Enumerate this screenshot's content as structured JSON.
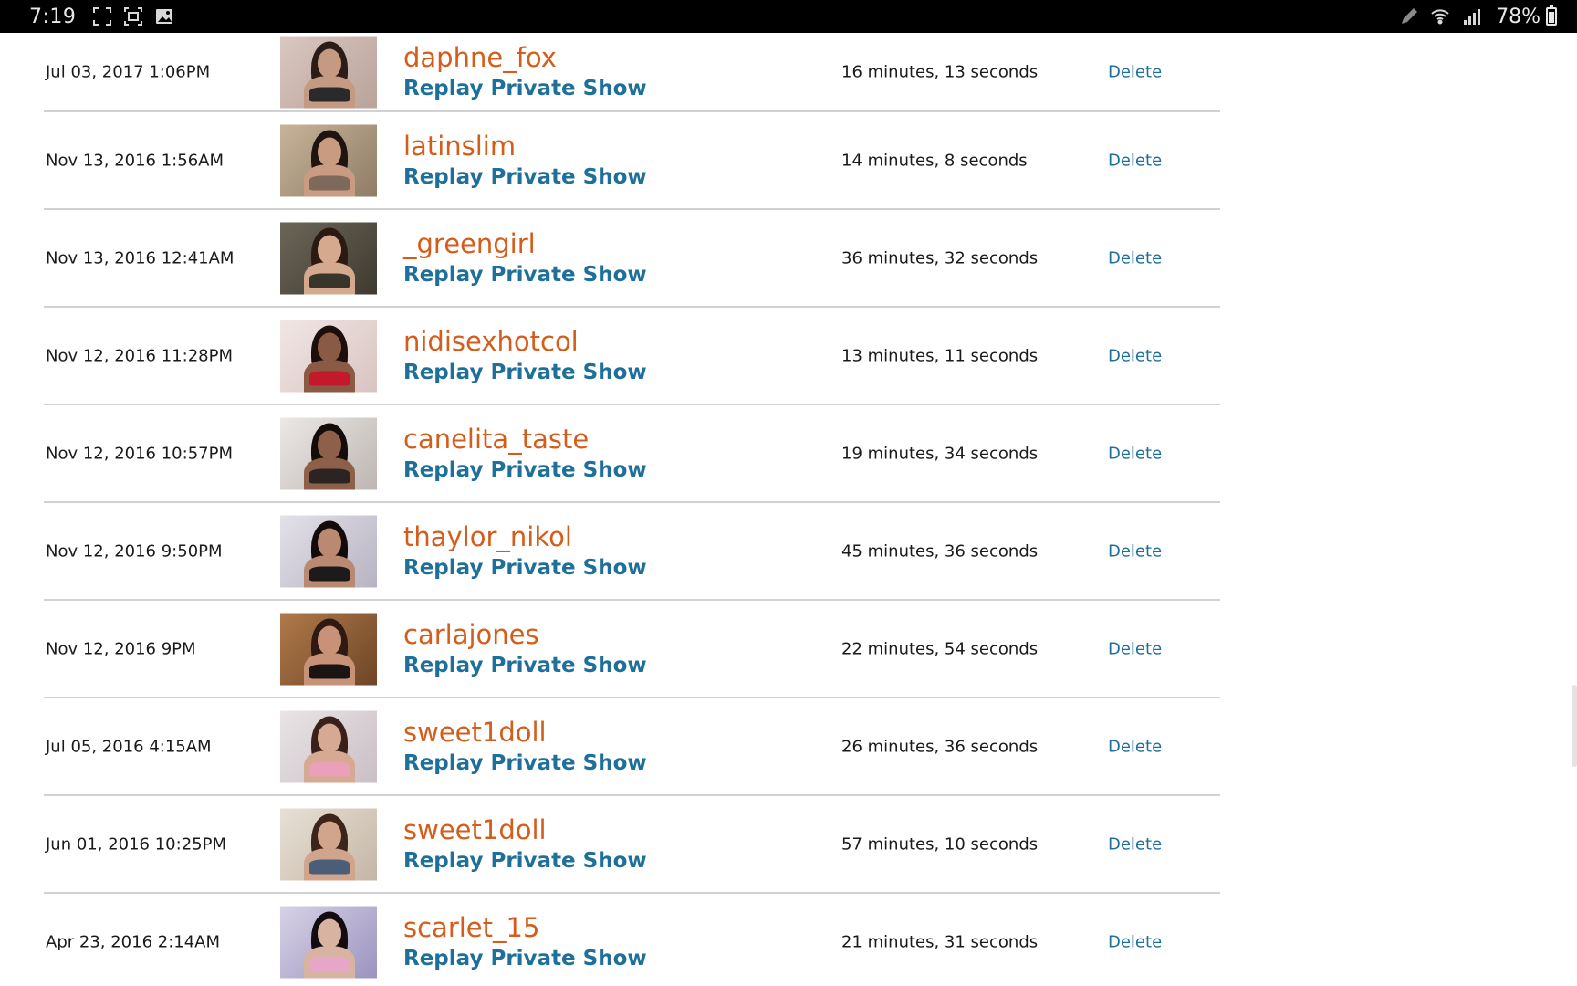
{
  "statusbar": {
    "time": "7:19",
    "battery": "78%",
    "battery_level": 0.78,
    "icons": [
      "expand-icon",
      "screenshot-icon",
      "gallery-icon",
      "pen-icon",
      "wifi-icon",
      "signal-icon",
      "battery-icon"
    ]
  },
  "history": {
    "rows": [
      {
        "date": "Jul 03, 2017 1:06PM",
        "username": "daphne_fox",
        "replay": "Replay Private Show",
        "duration": "16 minutes, 13 seconds",
        "action": "Delete"
      },
      {
        "date": "Nov 13, 2016 1:56AM",
        "username": "latinslim",
        "replay": "Replay Private Show",
        "duration": "14 minutes, 8 seconds",
        "action": "Delete"
      },
      {
        "date": "Nov 13, 2016 12:41AM",
        "username": "_greengirl",
        "replay": "Replay Private Show",
        "duration": "36 minutes, 32 seconds",
        "action": "Delete"
      },
      {
        "date": "Nov 12, 2016 11:28PM",
        "username": "nidisexhotcol",
        "replay": "Replay Private Show",
        "duration": "13 minutes, 11 seconds",
        "action": "Delete"
      },
      {
        "date": "Nov 12, 2016 10:57PM",
        "username": "canelita_taste",
        "replay": "Replay Private Show",
        "duration": "19 minutes, 34 seconds",
        "action": "Delete"
      },
      {
        "date": "Nov 12, 2016 9:50PM",
        "username": "thaylor_nikol",
        "replay": "Replay Private Show",
        "duration": "45 minutes, 36 seconds",
        "action": "Delete"
      },
      {
        "date": "Nov 12, 2016 9PM",
        "username": "carlajones",
        "replay": "Replay Private Show",
        "duration": "22 minutes, 54 seconds",
        "action": "Delete"
      },
      {
        "date": "Jul 05, 2016 4:15AM",
        "username": "sweet1doll",
        "replay": "Replay Private Show",
        "duration": "26 minutes, 36 seconds",
        "action": "Delete"
      },
      {
        "date": "Jun 01, 2016 10:25PM",
        "username": "sweet1doll",
        "replay": "Replay Private Show",
        "duration": "57 minutes, 10 seconds",
        "action": "Delete"
      },
      {
        "date": "Apr 23, 2016 2:14AM",
        "username": "scarlet_15",
        "replay": "Replay Private Show",
        "duration": "21 minutes, 31 seconds",
        "action": "Delete"
      }
    ]
  },
  "colors": {
    "username": "#d55d1c",
    "link": "#1f6f9b",
    "divider": "#d2d2d2",
    "text": "#1a1a1a",
    "statusbar_bg": "#000000"
  }
}
